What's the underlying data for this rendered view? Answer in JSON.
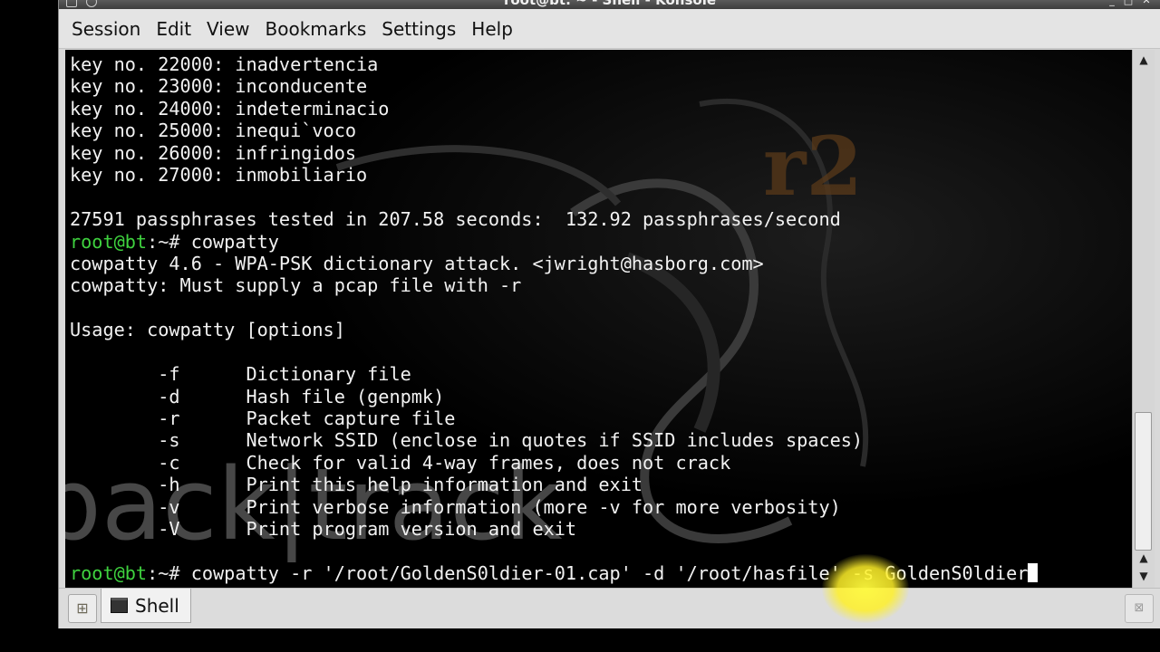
{
  "window": {
    "title": "root@bt: ~ - Shell - Konsole",
    "minimize_glyph": "_",
    "maximize_glyph": "□",
    "close_glyph": "✕"
  },
  "menu": {
    "items": [
      "Session",
      "Edit",
      "View",
      "Bookmarks",
      "Settings",
      "Help"
    ]
  },
  "terminal": {
    "prompt_user": "root@bt",
    "prompt_sep": ":~#",
    "lines": [
      {
        "kind": "text",
        "text": "key no. 22000: inadvertencia"
      },
      {
        "kind": "text",
        "text": "key no. 23000: inconducente"
      },
      {
        "kind": "text",
        "text": "key no. 24000: indeterminacio"
      },
      {
        "kind": "text",
        "text": "key no. 25000: inequi`voco"
      },
      {
        "kind": "text",
        "text": "key no. 26000: infringidos"
      },
      {
        "kind": "text",
        "text": "key no. 27000: inmobiliario"
      },
      {
        "kind": "text",
        "text": ""
      },
      {
        "kind": "text",
        "text": "27591 passphrases tested in 207.58 seconds:  132.92 passphrases/second"
      },
      {
        "kind": "prompt",
        "text": " cowpatty"
      },
      {
        "kind": "text",
        "text": "cowpatty 4.6 - WPA-PSK dictionary attack. <jwright@hasborg.com>"
      },
      {
        "kind": "text",
        "text": "cowpatty: Must supply a pcap file with -r"
      },
      {
        "kind": "text",
        "text": ""
      },
      {
        "kind": "text",
        "text": "Usage: cowpatty [options]"
      },
      {
        "kind": "text",
        "text": ""
      },
      {
        "kind": "text",
        "text": "        -f      Dictionary file"
      },
      {
        "kind": "text",
        "text": "        -d      Hash file (genpmk)"
      },
      {
        "kind": "text",
        "text": "        -r      Packet capture file"
      },
      {
        "kind": "text",
        "text": "        -s      Network SSID (enclose in quotes if SSID includes spaces)"
      },
      {
        "kind": "text",
        "text": "        -c      Check for valid 4-way frames, does not crack"
      },
      {
        "kind": "text",
        "text": "        -h      Print this help information and exit"
      },
      {
        "kind": "text",
        "text": "        -v      Print verbose information (more -v for more verbosity)"
      },
      {
        "kind": "text",
        "text": "        -V      Print program version and exit"
      },
      {
        "kind": "text",
        "text": ""
      },
      {
        "kind": "prompt",
        "text": " cowpatty -r '/root/GoldenS0ldier-01.cap' -d '/root/hasfile' -s GoldenS0ldier",
        "cursor": true
      }
    ]
  },
  "background": {
    "logo_text": "r2",
    "watermark_text": "back|track"
  },
  "tabs": {
    "items": [
      {
        "label": "Shell",
        "icon": "terminal-icon",
        "active": true
      }
    ],
    "new_tab_icon": "new-tab-icon",
    "close_tab_icon": "close-tab-icon"
  },
  "colors": {
    "prompt": "#3fd23f",
    "terminal_bg": "#000000",
    "terminal_fg": "#f2f2f2",
    "highlight": "#fff03c"
  }
}
